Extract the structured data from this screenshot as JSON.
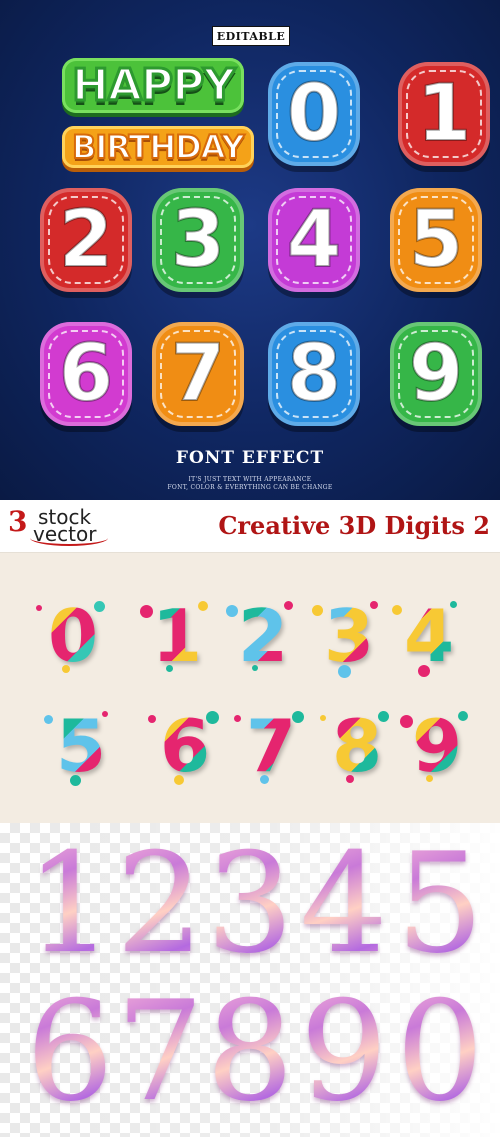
{
  "panel1": {
    "badge": "EDITABLE",
    "happy": "HAPPY",
    "birthday": "BIRTHDAY",
    "footer_title": "FONT EFFECT",
    "fine_print_1": "IT'S JUST TEXT WITH APPEARANCE",
    "fine_print_2": "FONT, COLOR & EVERYTHING CAN BE CHANGE",
    "digits": [
      {
        "char": "0",
        "color": "#2a8fe0"
      },
      {
        "char": "1",
        "color": "#d42a2a"
      },
      {
        "char": "2",
        "color": "#d42a2a"
      },
      {
        "char": "3",
        "color": "#36b648"
      },
      {
        "char": "4",
        "color": "#c43bd6"
      },
      {
        "char": "5",
        "color": "#f08d14"
      },
      {
        "char": "6",
        "color": "#d23bd0"
      },
      {
        "char": "7",
        "color": "#f08d14"
      },
      {
        "char": "8",
        "color": "#2a8fe0"
      },
      {
        "char": "9",
        "color": "#36b648"
      }
    ]
  },
  "title_band": {
    "logo_number": "3",
    "logo_word_1": "stock",
    "logo_word_2": "vector",
    "title": "Creative 3D Digits 2"
  },
  "panel2": {
    "digits": [
      {
        "char": "0",
        "colors": [
          "#f7c934",
          "#e5256f",
          "#35c7b5"
        ]
      },
      {
        "char": "1",
        "colors": [
          "#1eb99c",
          "#e5256f",
          "#f7c934"
        ]
      },
      {
        "char": "2",
        "colors": [
          "#1eb99c",
          "#5fc3ea",
          "#e5256f"
        ]
      },
      {
        "char": "3",
        "colors": [
          "#5fc3ea",
          "#f7c934",
          "#e5256f"
        ]
      },
      {
        "char": "4",
        "colors": [
          "#e5256f",
          "#f7c934",
          "#1eb99c"
        ]
      },
      {
        "char": "5",
        "colors": [
          "#1eb99c",
          "#5fc3ea",
          "#e5256f"
        ]
      },
      {
        "char": "6",
        "colors": [
          "#f7c934",
          "#e5256f",
          "#1eb99c"
        ]
      },
      {
        "char": "7",
        "colors": [
          "#5fc3ea",
          "#e5256f",
          "#1eb99c"
        ]
      },
      {
        "char": "8",
        "colors": [
          "#e5256f",
          "#f7c934",
          "#1eb99c"
        ]
      },
      {
        "char": "9",
        "colors": [
          "#f7c934",
          "#e5256f",
          "#1eb99c"
        ]
      }
    ]
  },
  "panel3": {
    "row1": [
      "1",
      "2",
      "3",
      "4",
      "5"
    ],
    "row2": [
      "6",
      "7",
      "8",
      "9",
      "0"
    ]
  }
}
